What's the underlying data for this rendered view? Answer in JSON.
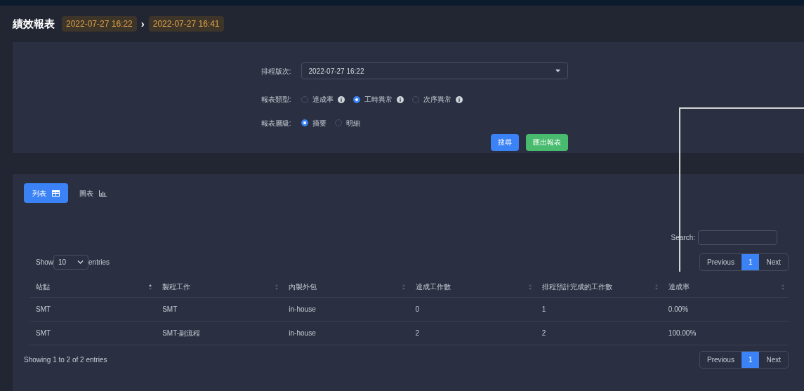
{
  "header": {
    "title": "績效報表",
    "start": "2022-07-27 16:22",
    "arrow": "›",
    "end": "2022-07-27 16:41"
  },
  "form": {
    "schedule": {
      "label": "排程版次:",
      "value": "2022-07-27 16:22"
    },
    "report_type": {
      "label": "報表類型:",
      "options": [
        {
          "label": "達成率",
          "selected": false,
          "info": true
        },
        {
          "label": "工時異常",
          "selected": true,
          "info": true
        },
        {
          "label": "次序異常",
          "selected": false,
          "info": true
        }
      ]
    },
    "report_level": {
      "label": "報表層級:",
      "options": [
        {
          "label": "摘要",
          "selected": true,
          "info": false
        },
        {
          "label": "明細",
          "selected": false,
          "info": false
        }
      ]
    },
    "buttons": [
      {
        "label": "搜尋",
        "kind": "primary"
      },
      {
        "label": "匯出報表",
        "kind": "success"
      }
    ]
  },
  "view_tabs": [
    {
      "label": "列表",
      "kind": "table",
      "selected": true
    },
    {
      "label": "圖表",
      "kind": "chart",
      "selected": false
    }
  ],
  "table": {
    "search_label": "Search:",
    "show_label": "Show",
    "page_size": "10",
    "entries_label": "entries",
    "pagination_top": {
      "previous": "Previous",
      "pages": [
        {
          "label": "1",
          "selected": true
        }
      ],
      "next": "Next"
    },
    "columns": [
      {
        "label": "站點",
        "sorted": true
      },
      {
        "label": "製程工作",
        "sorted": false
      },
      {
        "label": "內製外包",
        "sorted": false
      },
      {
        "label": "達成工作數",
        "sorted": false
      },
      {
        "label": "排程預計完成的工作數",
        "sorted": false
      },
      {
        "label": "達成率",
        "sorted": false
      }
    ],
    "rows": [
      [
        "SMT",
        "SMT",
        "in-house",
        "0",
        "1",
        "0.00%"
      ],
      [
        "SMT",
        "SMT-副流程",
        "in-house",
        "2",
        "2",
        "100.00%"
      ]
    ],
    "info": "Showing 1 to 2 of 2 entries",
    "pagination_bottom": {
      "previous": "Previous",
      "pages": [
        {
          "label": "1",
          "selected": true
        }
      ],
      "next": "Next"
    }
  }
}
